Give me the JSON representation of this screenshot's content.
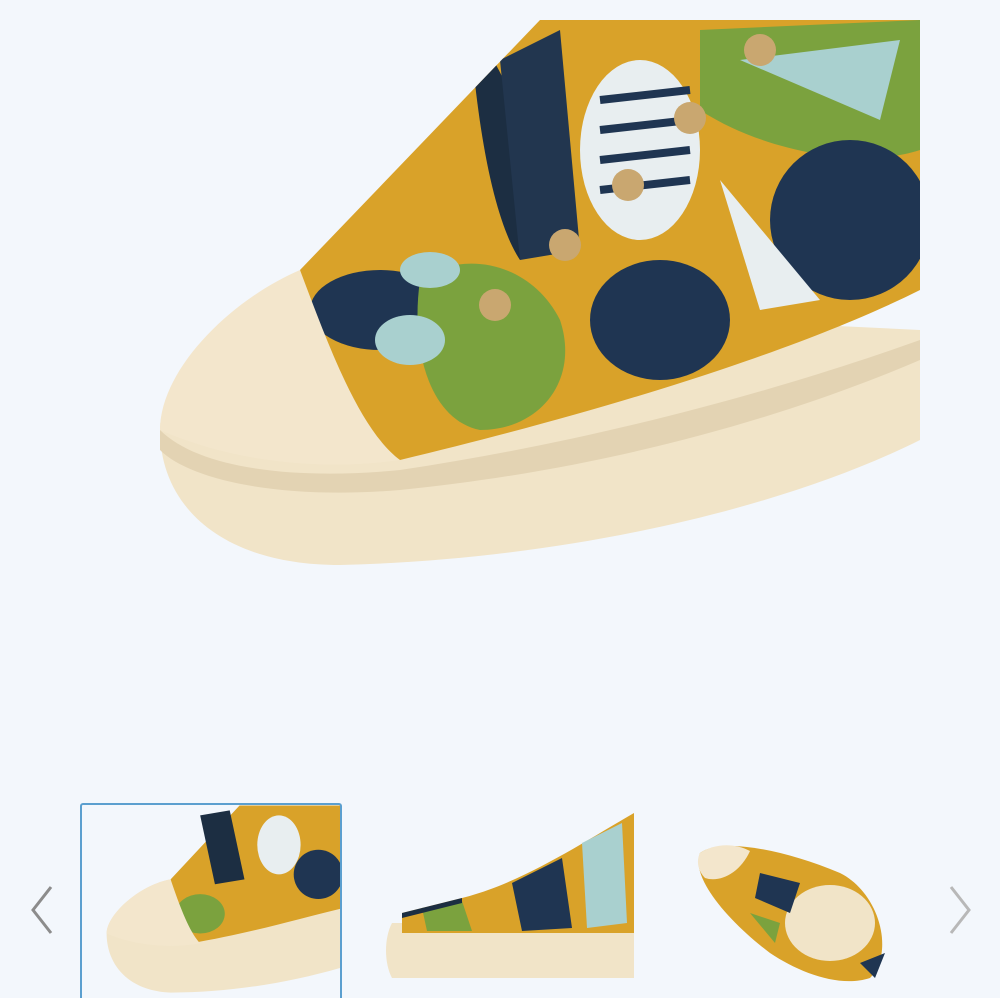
{
  "gallery": {
    "selected_index": 0,
    "main_image": {
      "icon": "shoe-toe-closeup-image",
      "pattern_colors": [
        "#d9a229",
        "#1f3552",
        "#7ba23e",
        "#a9d0cf",
        "#e8eef0"
      ],
      "sole_color": "#f3e6cc"
    },
    "thumbnails": [
      {
        "name": "toe-closeup"
      },
      {
        "name": "side-profile"
      },
      {
        "name": "top-angle"
      }
    ],
    "prev_icon": "chevron-left-icon",
    "next_icon": "chevron-right-icon"
  }
}
